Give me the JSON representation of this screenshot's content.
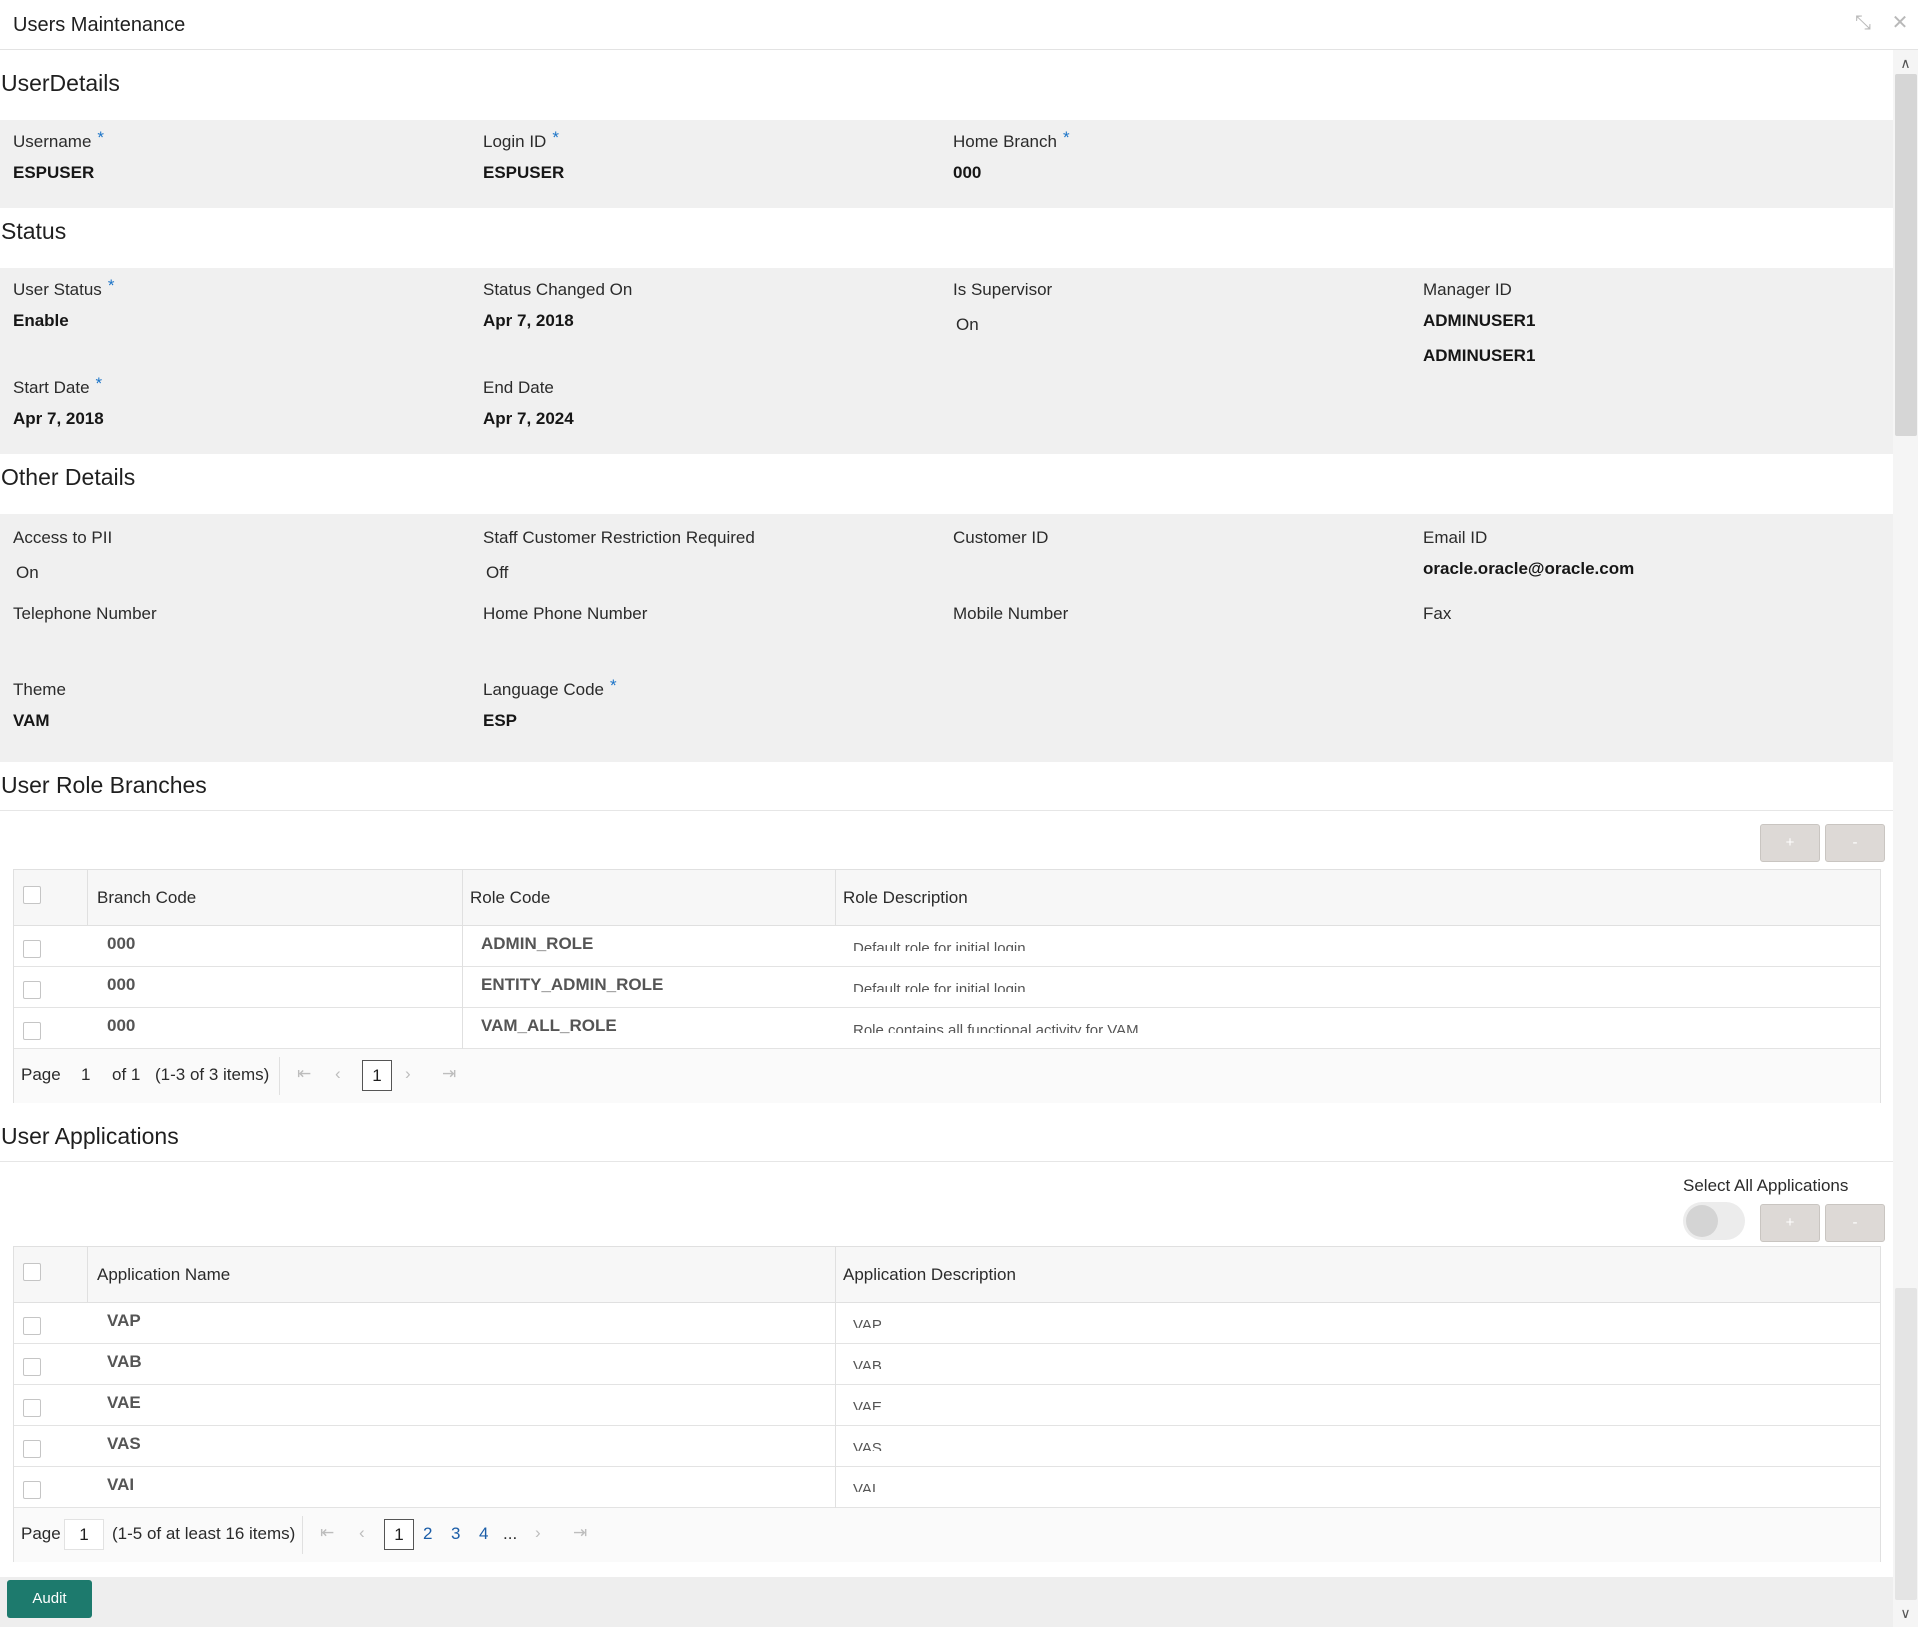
{
  "window": {
    "title": "Users Maintenance"
  },
  "user_details": {
    "section_title": "UserDetails",
    "username": {
      "label": "Username",
      "value": "ESPUSER"
    },
    "login_id": {
      "label": "Login ID",
      "value": "ESPUSER"
    },
    "home_branch": {
      "label": "Home Branch",
      "value": "000"
    },
    "required_mark": "*"
  },
  "status": {
    "section_title": "Status",
    "user_status": {
      "label": "User Status",
      "value": "Enable"
    },
    "status_changed_on": {
      "label": "Status Changed On",
      "value": "Apr 7, 2018"
    },
    "is_supervisor": {
      "label": "Is Supervisor",
      "value": "On"
    },
    "manager_id": {
      "label": "Manager ID",
      "value": "ADMINUSER1",
      "value2": "ADMINUSER1"
    },
    "start_date": {
      "label": "Start Date",
      "value": "Apr 7, 2018"
    },
    "end_date": {
      "label": "End Date",
      "value": "Apr 7, 2024"
    }
  },
  "other_details": {
    "section_title": "Other Details",
    "access_to_pii": {
      "label": "Access to PII",
      "value": "On"
    },
    "staff_customer_restriction": {
      "label": "Staff Customer Restriction Required",
      "value": "Off"
    },
    "customer_id": {
      "label": "Customer ID",
      "value": ""
    },
    "email_id": {
      "label": "Email ID",
      "value": "oracle.oracle@oracle.com"
    },
    "telephone_number": {
      "label": "Telephone Number",
      "value": ""
    },
    "home_phone_number": {
      "label": "Home Phone Number",
      "value": ""
    },
    "mobile_number": {
      "label": "Mobile Number",
      "value": ""
    },
    "fax": {
      "label": "Fax",
      "value": ""
    },
    "theme": {
      "label": "Theme",
      "value": "VAM"
    },
    "language_code": {
      "label": "Language Code",
      "value": "ESP"
    }
  },
  "user_role_branches": {
    "section_title": "User Role Branches",
    "add_label": "+",
    "remove_label": "-",
    "columns": [
      "Branch Code",
      "Role Code",
      "Role Description"
    ],
    "rows": [
      {
        "branch": "000",
        "role": "ADMIN_ROLE",
        "description": "Default role for initial login"
      },
      {
        "branch": "000",
        "role": "ENTITY_ADMIN_ROLE",
        "description": "Default role for initial login"
      },
      {
        "branch": "000",
        "role": "VAM_ALL_ROLE",
        "description": "Role contains all functional activity for VAM"
      }
    ],
    "pager": {
      "page_label": "Page",
      "page_value": "1",
      "of_text": "of 1",
      "items_text": "(1-3 of 3 items)",
      "current": "1"
    }
  },
  "user_applications": {
    "section_title": "User Applications",
    "select_all_label": "Select All Applications",
    "add_label": "+",
    "remove_label": "-",
    "columns": [
      "Application Name",
      "Application Description"
    ],
    "rows": [
      {
        "name": "VAP",
        "description": "VAP"
      },
      {
        "name": "VAB",
        "description": "VAB"
      },
      {
        "name": "VAE",
        "description": "VAE"
      },
      {
        "name": "VAS",
        "description": "VAS"
      },
      {
        "name": "VAI",
        "description": "VAI"
      }
    ],
    "pager": {
      "page_label": "Page",
      "page_value": "1",
      "items_text": "(1-5 of at least 16 items)",
      "current": "1",
      "pages": [
        "2",
        "3",
        "4"
      ],
      "ellipsis": "..."
    }
  },
  "footer": {
    "audit_label": "Audit"
  },
  "icons": {
    "minimize": "collapse-arrows-icon",
    "close": "close-icon"
  }
}
